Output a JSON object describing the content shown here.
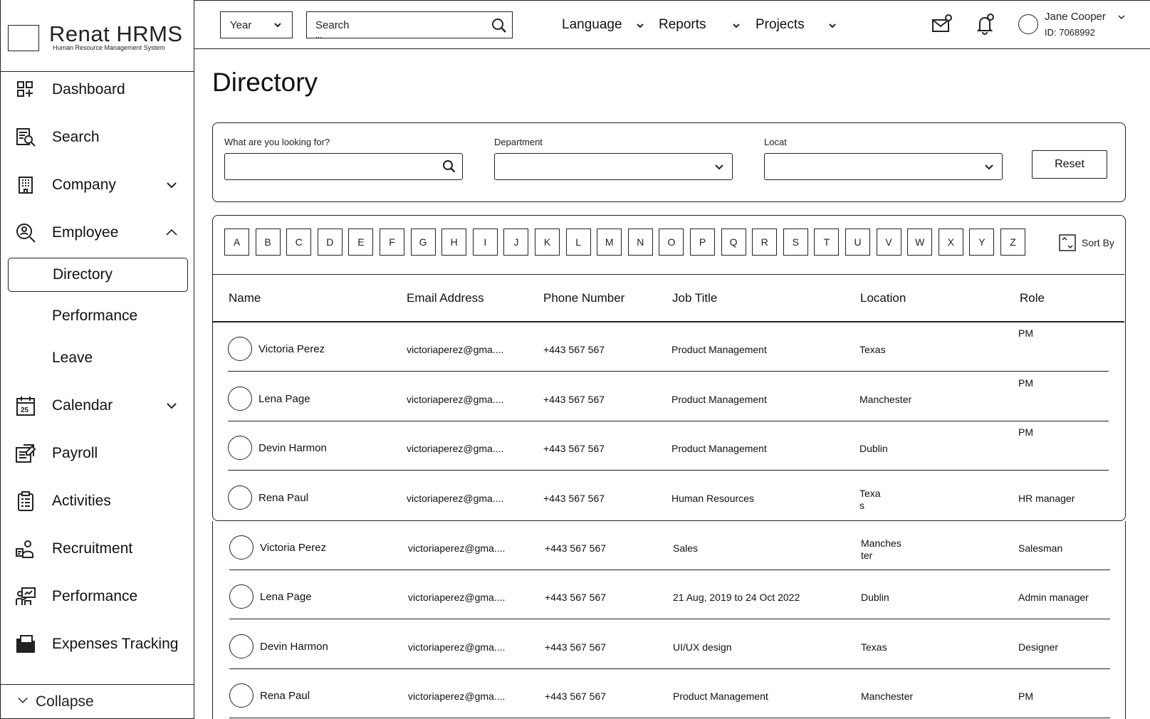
{
  "brand": {
    "name": "Renat HRMS",
    "subtitle": "Human Resource Management System"
  },
  "sidebar": {
    "items": [
      {
        "label": "Dashboard",
        "icon": "dashboard-icon"
      },
      {
        "label": "Search",
        "icon": "search-doc-icon"
      },
      {
        "label": "Company",
        "icon": "building-icon",
        "chevron": "down"
      },
      {
        "label": "Employee",
        "icon": "employee-search-icon",
        "chevron": "up"
      },
      {
        "label": "Calendar",
        "icon": "calendar-icon",
        "chevron": "down",
        "badge": "25"
      },
      {
        "label": "Payroll",
        "icon": "payroll-icon"
      },
      {
        "label": "Activities",
        "icon": "clipboard-icon"
      },
      {
        "label": "Recruitment",
        "icon": "recruitment-icon"
      },
      {
        "label": "Performance",
        "icon": "presentation-icon"
      },
      {
        "label": "Expenses Tracking",
        "icon": "folder-icon"
      }
    ],
    "sub_items": [
      {
        "label": "Directory",
        "active": true
      },
      {
        "label": "Performance",
        "active": false
      },
      {
        "label": "Leave",
        "active": false
      }
    ],
    "collapse_label": "Collapse"
  },
  "header": {
    "year_label": "Year",
    "search_label": "Search",
    "search_dots": "...",
    "menus": [
      "Language",
      "Reports",
      "Projects"
    ],
    "user": {
      "name": "Jane Cooper",
      "id": "ID: 7068992"
    }
  },
  "page": {
    "title": "Directory"
  },
  "filters": {
    "query_label": "What are you looking for?",
    "department_label": "Department",
    "location_label": "Locat",
    "reset_label": "Reset"
  },
  "alphabet": [
    "A",
    "B",
    "C",
    "D",
    "E",
    "F",
    "G",
    "H",
    "I",
    "J",
    "K",
    "L",
    "M",
    "N",
    "O",
    "P",
    "Q",
    "R",
    "S",
    "T",
    "U",
    "V",
    "W",
    "X",
    "Y",
    "Z"
  ],
  "sort_label": "Sort By",
  "table": {
    "headers": [
      "Name",
      "Email Address",
      "Phone Number",
      "Job Title",
      "Location",
      "Role"
    ],
    "rows": [
      {
        "name": "Victoria Perez",
        "email": "victoriaperez@gma....",
        "phone": "+443 567 567",
        "job": "Product Management",
        "location": "Texas",
        "location2": "",
        "role": "PM"
      },
      {
        "name": "Lena Page",
        "email": "victoriaperez@gma....",
        "phone": "+443 567 567",
        "job": "Product Management",
        "location": "Manchester",
        "location2": "",
        "role": "PM"
      },
      {
        "name": "Devin Harmon",
        "email": "victoriaperez@gma....",
        "phone": "+443 567 567",
        "job": "Product Management",
        "location": "Dublin",
        "location2": "",
        "role": "PM"
      },
      {
        "name": "Rena Paul",
        "email": "victoriaperez@gma....",
        "phone": "+443 567 567",
        "job": "Human Resources",
        "location": "Texa",
        "location2": "s",
        "role": "HR manager"
      },
      {
        "name": "Victoria Perez",
        "email": "victoriaperez@gma....",
        "phone": "+443 567 567",
        "job": "Sales",
        "location": "Manches",
        "location2": "ter",
        "role": "Salesman"
      },
      {
        "name": "Lena Page",
        "email": "victoriaperez@gma....",
        "phone": "+443 567 567",
        "job": "21 Aug, 2019 to 24 Oct 2022",
        "location": "Dublin",
        "location2": "",
        "role": "Admin manager"
      },
      {
        "name": "Devin Harmon",
        "email": "victoriaperez@gma....",
        "phone": "+443 567 567",
        "job": "UI/UX design",
        "location": "Texas",
        "location2": "",
        "role": "Designer"
      },
      {
        "name": "Rena Paul",
        "email": "victoriaperez@gma....",
        "phone": "+443 567 567",
        "job": "Product Management",
        "location": "Manchester",
        "location2": "",
        "role": "PM"
      }
    ]
  }
}
